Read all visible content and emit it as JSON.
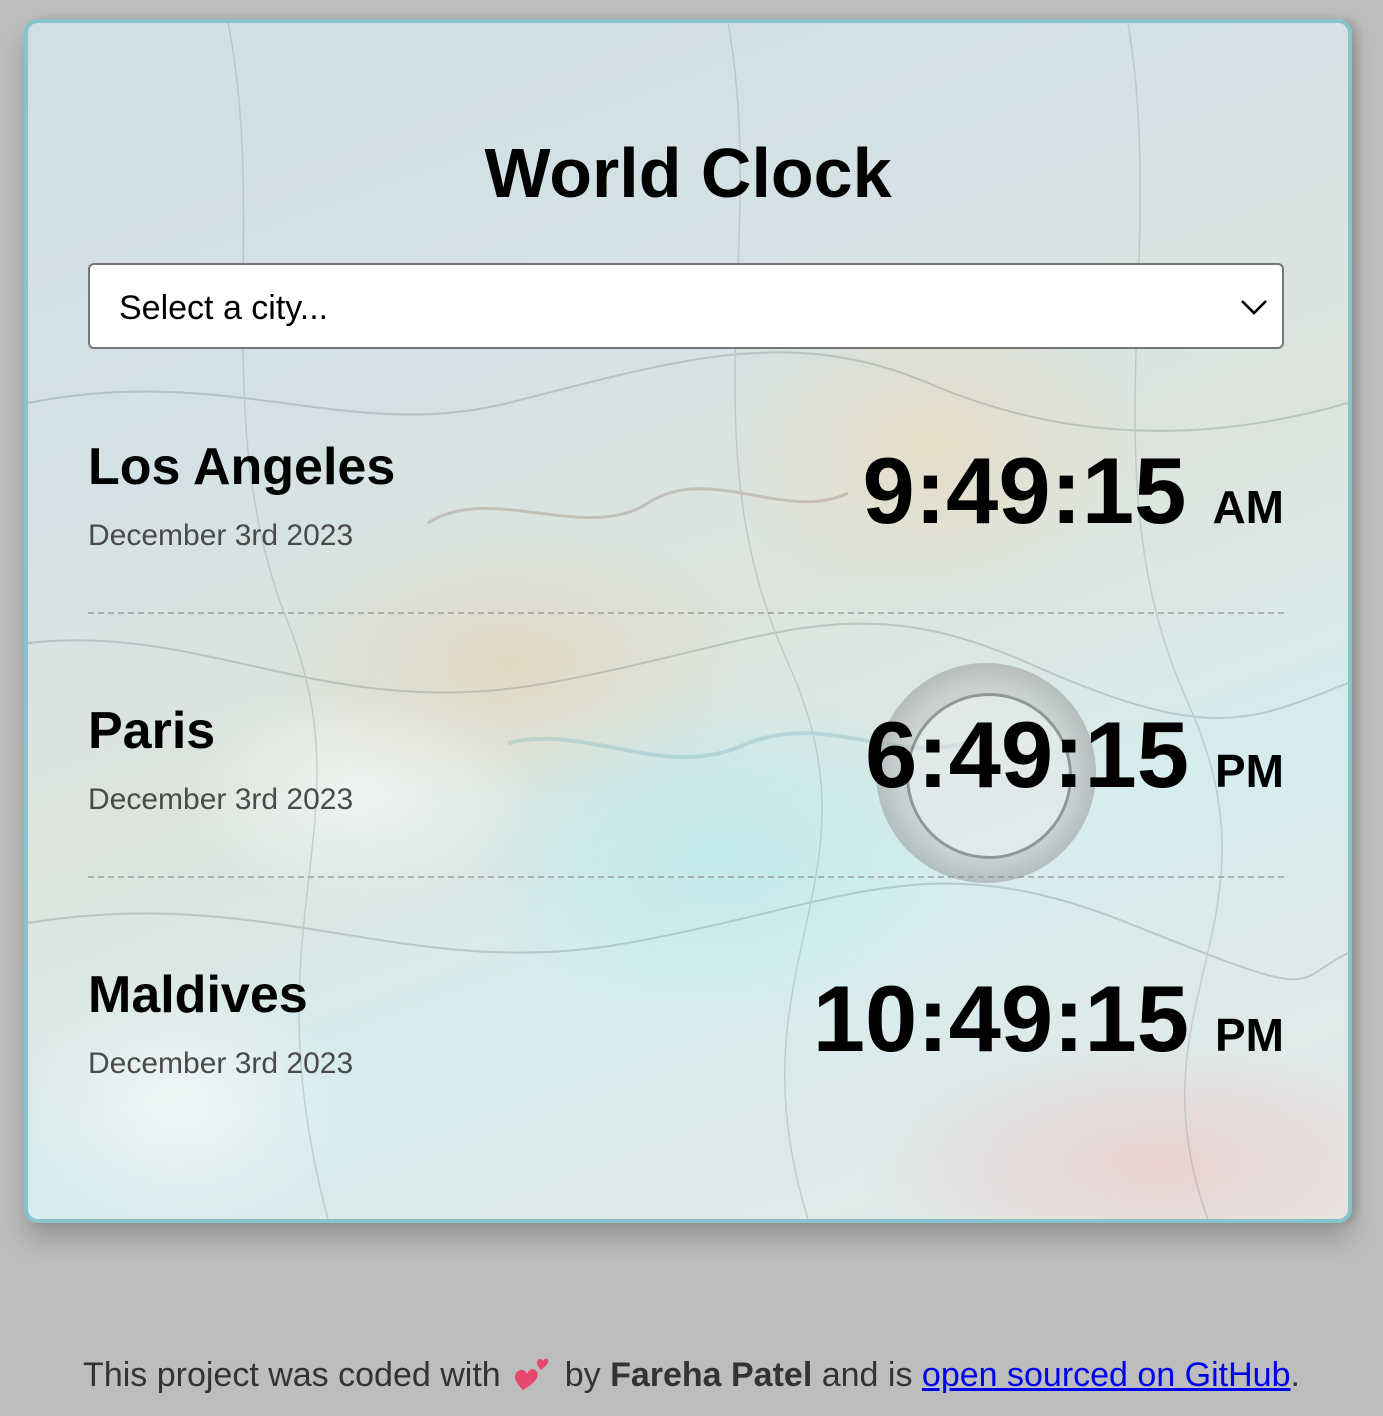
{
  "app": {
    "title": "World Clock"
  },
  "city_select": {
    "value": "Select a city..."
  },
  "cities": [
    {
      "name": "Los Angeles",
      "date": "December 3rd 2023",
      "time": "9:49:15",
      "ampm": "AM"
    },
    {
      "name": "Paris",
      "date": "December 3rd 2023",
      "time": "6:49:15",
      "ampm": "PM"
    },
    {
      "name": "Maldives",
      "date": "December 3rd 2023",
      "time": "10:49:15",
      "ampm": "PM"
    }
  ],
  "footer": {
    "prefix": "This project was coded with",
    "by": "by",
    "author": "Fareha Patel",
    "middle": "and is",
    "link_text": "open sourced on GitHub",
    "suffix": "."
  },
  "colors": {
    "page_background": "#bdbdbd",
    "card_border": "#86c3cc",
    "link": "#0000ee",
    "heart": "#e8476d"
  },
  "icons": {
    "select": "chevron-down-icon",
    "footer": "two-hearts-icon"
  }
}
